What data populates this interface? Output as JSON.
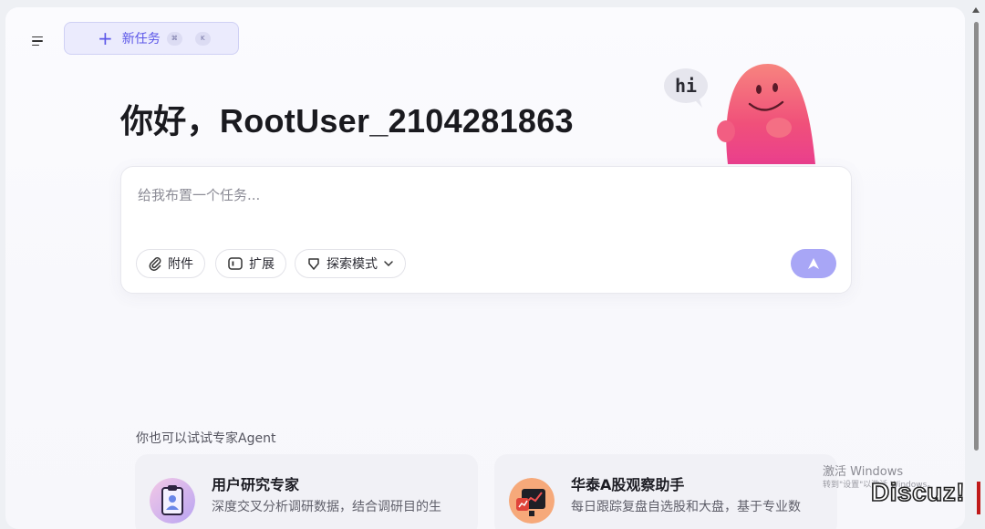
{
  "sidebar": {
    "toggle_icon": "menu-icon"
  },
  "header": {
    "new_task_label": "新任务",
    "shortcut_keys": [
      "⌘",
      "K"
    ]
  },
  "greeting": "你好，RootUser_2104281863",
  "mascot": {
    "speech": "hi"
  },
  "composer": {
    "placeholder": "给我布置一个任务...",
    "attach_label": "附件",
    "extend_label": "扩展",
    "mode_label": "探索模式",
    "send_icon": "send-icon"
  },
  "agents": {
    "title": "你也可以试试专家Agent",
    "items": [
      {
        "name": "用户研究专家",
        "desc": "深度交叉分析调研数据，结合调研目的生"
      },
      {
        "name": "华泰A股观察助手",
        "desc": "每日跟踪复盘自选股和大盘，基于专业数"
      }
    ]
  },
  "overlay": {
    "activate_title": "激活 Windows",
    "activate_hint": "转到\"设置\"以激活 Windows。",
    "brand": "Discuz!"
  },
  "colors": {
    "accent": "#5b56e8",
    "send_button": "#a8a6f6",
    "mascot": "#f0507a"
  }
}
